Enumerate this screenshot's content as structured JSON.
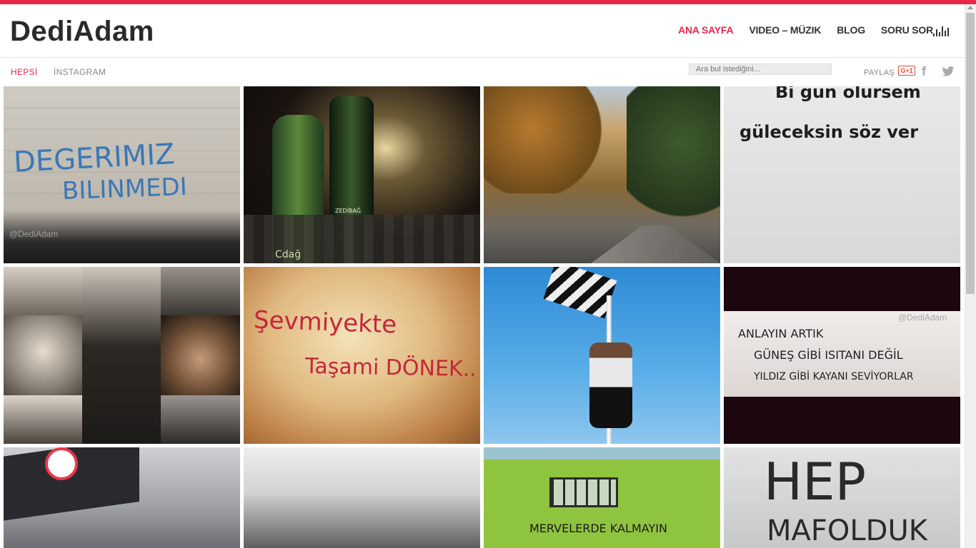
{
  "brand": {
    "logo": "DediAdam",
    "accent": "#e8284a"
  },
  "nav": {
    "items": [
      {
        "label": "ANA SAYFA",
        "active": true
      },
      {
        "label": "VIDEO – MÜZIK",
        "active": false
      },
      {
        "label": "BLOG",
        "active": false
      },
      {
        "label": "SORU SOR",
        "active": false
      }
    ],
    "extra_icon": "equalizer-icon"
  },
  "filters": {
    "all": "HEPSİ",
    "instagram": "İNSTAGRAM"
  },
  "search": {
    "placeholder": "Ara bul istediğini..."
  },
  "share": {
    "label": "PAYLAŞ",
    "gplus": "G+1",
    "icons": [
      "google-plus-icon",
      "facebook-icon",
      "twitter-icon"
    ]
  },
  "tiles": [
    {
      "name": "photo-wall-graffiti-blue",
      "lines": [
        "DEGERIMIZ",
        "BILINMEDI"
      ],
      "watermark": "@DediAdam"
    },
    {
      "name": "photo-night-bottles",
      "lines": [
        "ZEDİBAĞ",
        "Cdağ"
      ]
    },
    {
      "name": "photo-autumn-street",
      "lines": []
    },
    {
      "name": "photo-wall-text-smile",
      "lines": [
        "Bi gün ölürsem",
        "güleceksin söz ver"
      ]
    },
    {
      "name": "photo-ataturk-collage",
      "lines": []
    },
    {
      "name": "photo-wall-red-graffiti",
      "lines": [
        "Şevmiyekte",
        "Taşami DÖNEK.."
      ]
    },
    {
      "name": "photo-flag-pole",
      "lines": []
    },
    {
      "name": "photo-sign-anlayin",
      "lines": [
        "ANLAYIN ARTIK",
        "GÜNEŞ GİBİ ISITANI DEĞİL",
        "YILDIZ GİBİ KAYANI SEVİYORLAR"
      ],
      "watermark": "@DediAdam"
    },
    {
      "name": "photo-bjk-flag",
      "lines": []
    },
    {
      "name": "photo-cloudy-sky",
      "lines": []
    },
    {
      "name": "photo-green-wall",
      "lines": [
        "MERVELERDE KALMAYIN"
      ]
    },
    {
      "name": "photo-wall-hep",
      "lines": [
        "HEP",
        "MAFOLDUK"
      ]
    }
  ]
}
